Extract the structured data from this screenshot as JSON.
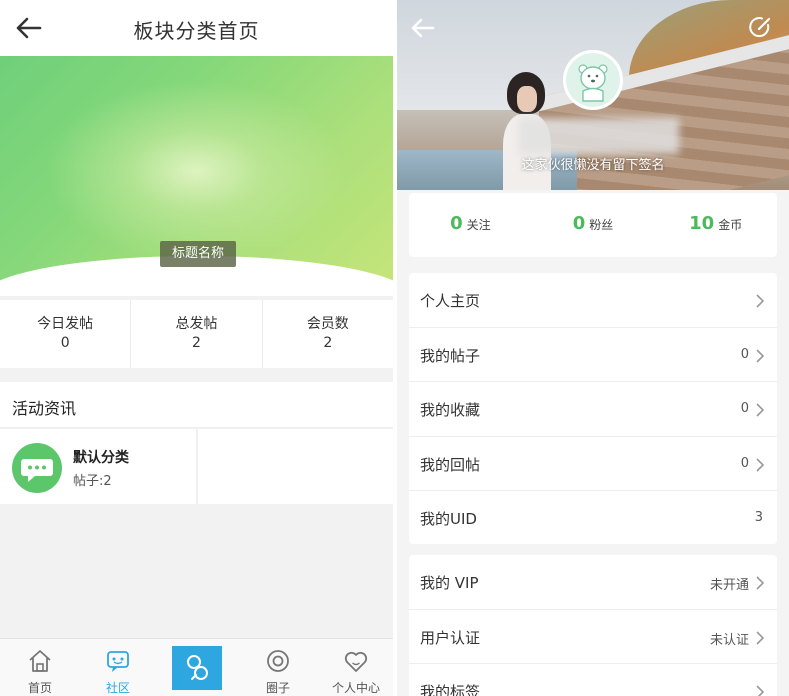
{
  "left_screen": {
    "header": {
      "title": "板块分类首页"
    },
    "banner": {
      "badge": "标题名称"
    },
    "stats": [
      {
        "label": "今日发帖",
        "value": "0"
      },
      {
        "label": "总发帖",
        "value": "2"
      },
      {
        "label": "会员数",
        "value": "2"
      }
    ],
    "section_title": "活动资讯",
    "category": {
      "name": "默认分类",
      "count": "帖子:2"
    },
    "tabbar": [
      {
        "label": "首页",
        "icon": "home-icon",
        "active": false
      },
      {
        "label": "社区",
        "icon": "community-icon",
        "active": true
      },
      {
        "label": "",
        "icon": "publish-icon",
        "active": false
      },
      {
        "label": "圈子",
        "icon": "circle-icon",
        "active": false
      },
      {
        "label": "个人中心",
        "icon": "heart-face-icon",
        "active": false
      }
    ],
    "colors": {
      "accent_green": "#5cc66a",
      "tab_active": "#2ea7e0"
    }
  },
  "right_screen": {
    "signature": "这家伙很懒没有留下签名",
    "stats": [
      {
        "number": "0",
        "label": "关注"
      },
      {
        "number": "0",
        "label": "粉丝"
      },
      {
        "number": "10",
        "label": "金币"
      }
    ],
    "menu_group_1": [
      {
        "label": "个人主页",
        "value": ""
      },
      {
        "label": "我的帖子",
        "value": "0"
      },
      {
        "label": "我的收藏",
        "value": "0"
      },
      {
        "label": "我的回帖",
        "value": "0"
      },
      {
        "label": "我的UID",
        "value": "3"
      }
    ],
    "menu_group_2": [
      {
        "label": "我的 VIP",
        "value": "未开通"
      },
      {
        "label": "用户认证",
        "value": "未认证"
      },
      {
        "label": "我的标签",
        "value": ""
      }
    ],
    "colors": {
      "stat_green": "#4cb95a"
    }
  }
}
